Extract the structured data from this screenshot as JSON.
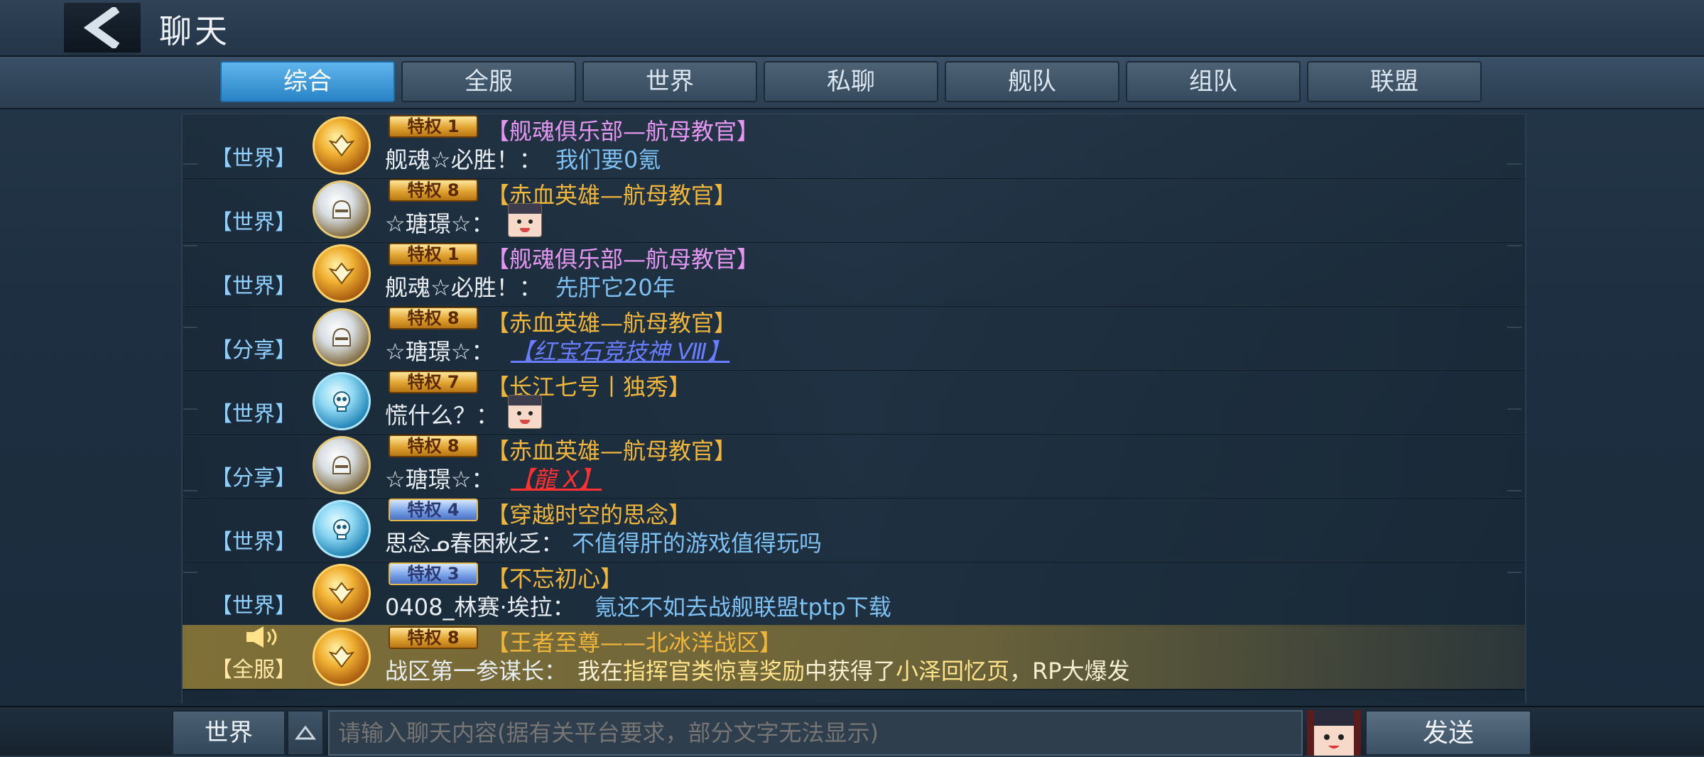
{
  "header": {
    "title": "聊天"
  },
  "tabs": [
    {
      "label": "综合",
      "active": true
    },
    {
      "label": "全服",
      "active": false
    },
    {
      "label": "世界",
      "active": false
    },
    {
      "label": "私聊",
      "active": false
    },
    {
      "label": "舰队",
      "active": false
    },
    {
      "label": "组队",
      "active": false
    },
    {
      "label": "联盟",
      "active": false
    }
  ],
  "messages": [
    {
      "channel": "【世界】",
      "avatar": "gold-avatar",
      "badge": "特权 1",
      "tag": "【舰魂俱乐部—航母教官】",
      "tag_color": "#e496f0",
      "name": "舰魂☆必胜！：",
      "text": "我们要0氪"
    },
    {
      "channel": "【世界】",
      "avatar": "silver-avatar",
      "badge": "特权 8",
      "tag": "【赤血英雄—航母教官】",
      "tag_color": "#f0b63c",
      "name": "☆瑭璟☆：",
      "text": "",
      "emoji": "sticker-emoji"
    },
    {
      "channel": "【世界】",
      "avatar": "gold-avatar",
      "badge": "特权 1",
      "tag": "【舰魂俱乐部—航母教官】",
      "tag_color": "#e496f0",
      "name": "舰魂☆必胜！：",
      "text": "先肝它20年"
    },
    {
      "channel": "【分享】",
      "avatar": "silver-avatar",
      "badge": "特权 8",
      "tag": "【赤血英雄—航母教官】",
      "tag_color": "#f0b63c",
      "name": "☆瑭璟☆：",
      "text": "【红宝石竞技神 Ⅷ】",
      "style": "link"
    },
    {
      "channel": "【世界】",
      "avatar": "blue-avatar",
      "badge": "特权 7",
      "tag": "【长江七号丨独秀】",
      "tag_color": "#f0b63c",
      "name": "慌什么？：",
      "text": "",
      "emoji": "sticker-emoji"
    },
    {
      "channel": "【分享】",
      "avatar": "silver-avatar",
      "badge": "特权 8",
      "tag": "【赤血英雄—航母教官】",
      "tag_color": "#f0b63c",
      "name": "☆瑭璟☆：",
      "text": "【龍 X】",
      "style": "red"
    },
    {
      "channel": "【世界】",
      "avatar": "blue-avatar",
      "badge": "特权 4",
      "tag": "【穿越时空的思念】",
      "tag_color": "#f0b63c",
      "name": "思念ᓄ春困秋乏：",
      "text": "不值得肝的游戏值得玩吗",
      "badge_style": "blue"
    },
    {
      "channel": "【世界】",
      "avatar": "gold-avatar",
      "badge": "特权 3",
      "tag": "【不忘初心】",
      "tag_color": "#f0b63c",
      "name": "0408_林赛·埃拉：",
      "text": "氪还不如去战舰联盟tptp下载",
      "badge_style": "blue"
    },
    {
      "channel": "【全服】",
      "avatar": "gold-avatar",
      "badge": "特权 8",
      "tag": "【王者至尊——北冰洋战区】",
      "tag_color": "#f0b63c",
      "name": "战区第一参谋长：",
      "system": {
        "p1": "我在",
        "p2": "指挥官类惊喜奖励",
        "p3": "中获得了",
        "p4": "小泽回忆页",
        "p5": "，RP大爆发"
      },
      "highlight": true
    }
  ],
  "input": {
    "channel_label": "世界",
    "placeholder": "请输入聊天内容(据有关平台要求，部分文字无法显示)"
  },
  "send_label": "发送"
}
